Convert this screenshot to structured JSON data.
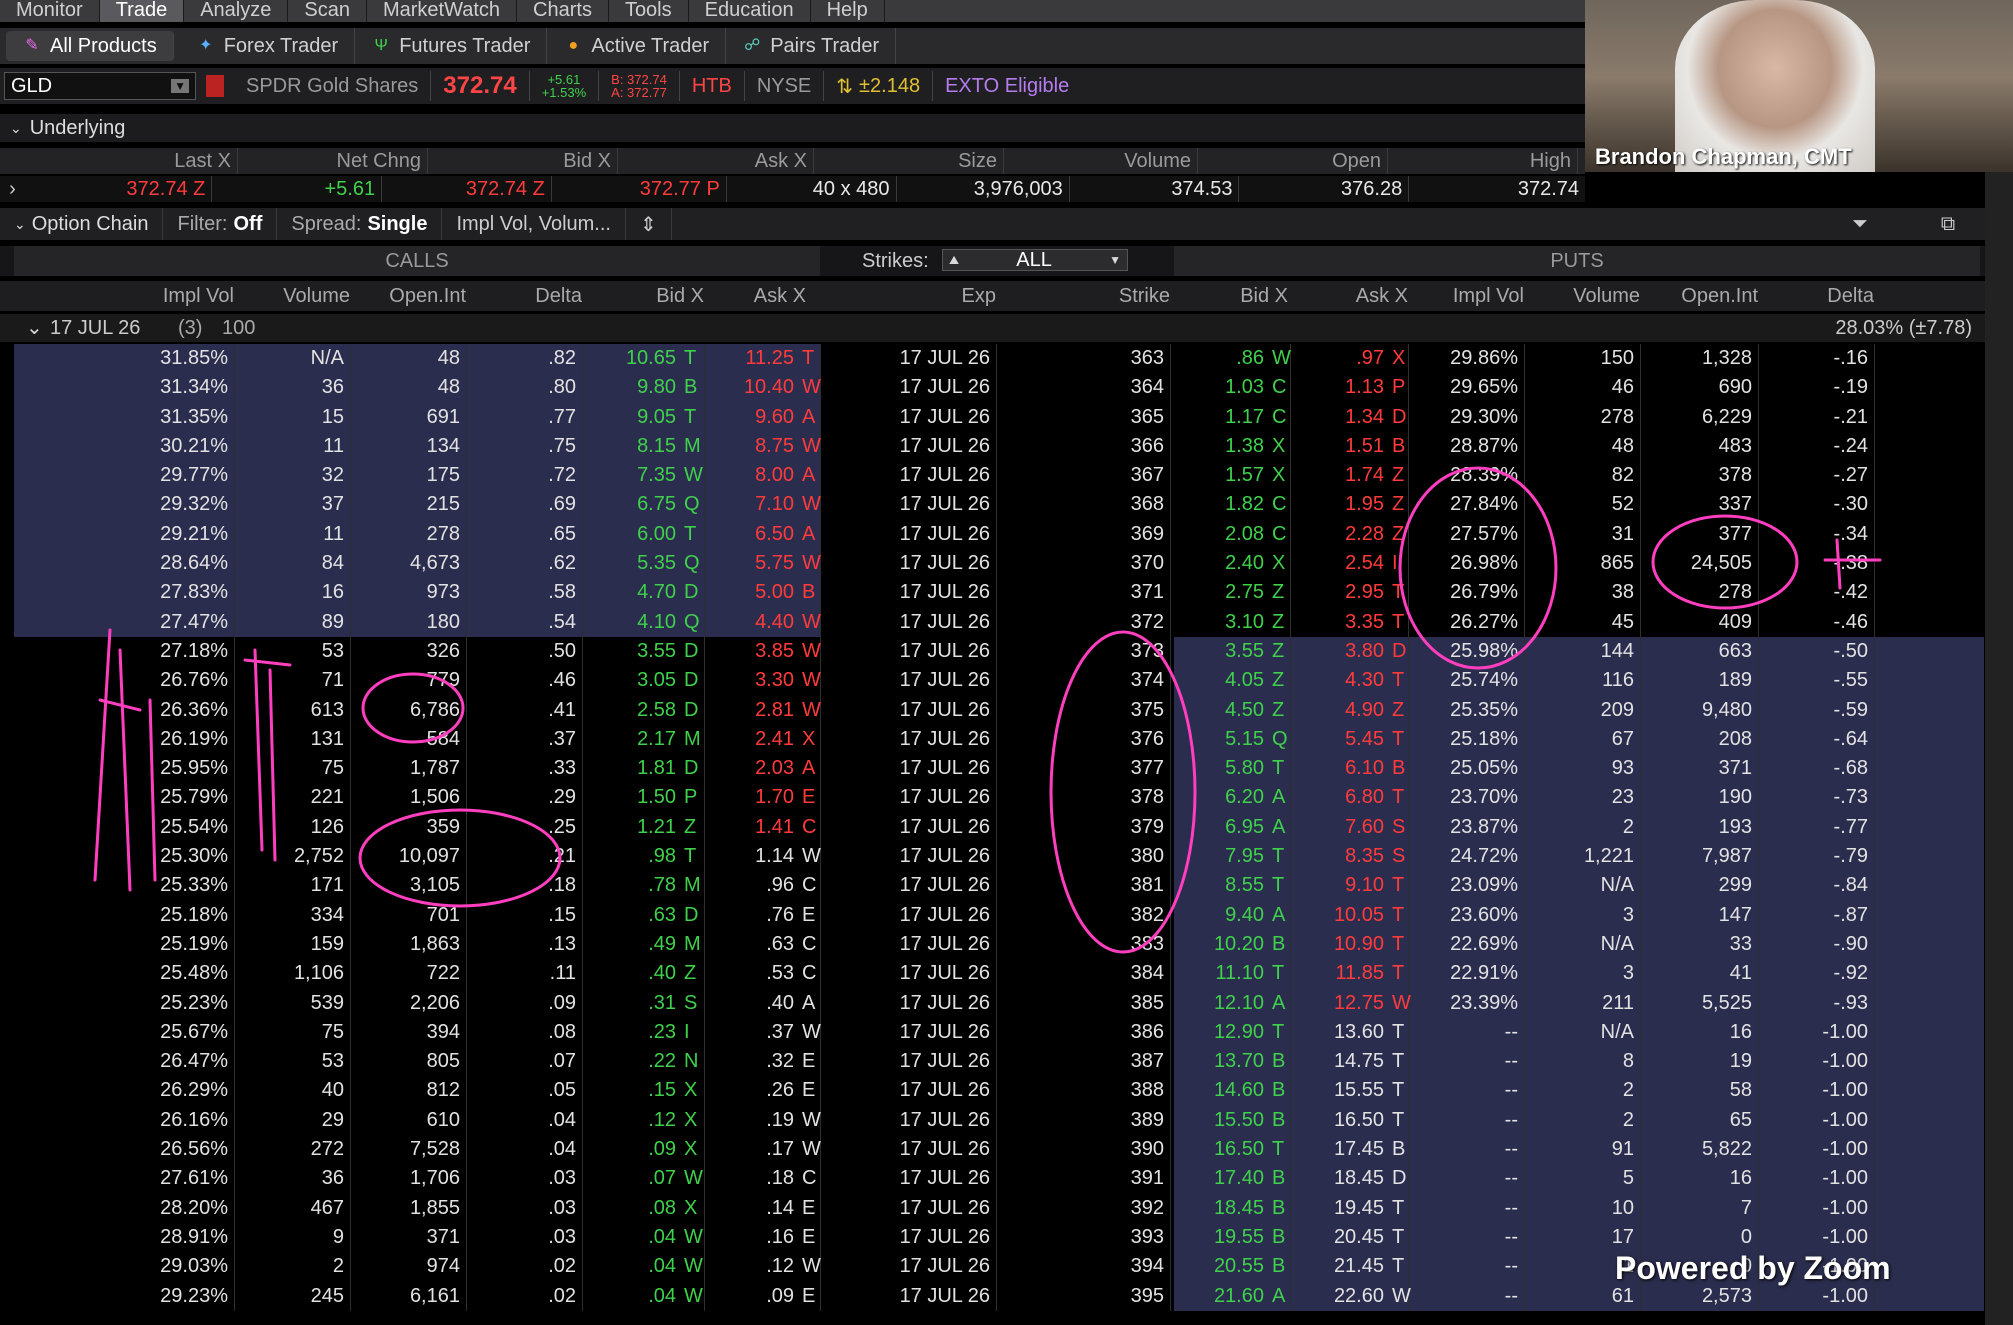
{
  "menu": [
    "Monitor",
    "Trade",
    "Analyze",
    "Scan",
    "MarketWatch",
    "Charts",
    "Tools",
    "Education",
    "Help"
  ],
  "products": [
    {
      "label": "All Products",
      "icon": "all-products-icon"
    },
    {
      "label": "Forex Trader",
      "icon": "forex-icon"
    },
    {
      "label": "Futures Trader",
      "icon": "futures-icon"
    },
    {
      "label": "Active Trader",
      "icon": "active-trader-icon"
    },
    {
      "label": "Pairs Trader",
      "icon": "pairs-icon"
    }
  ],
  "symbol": {
    "ticker": "GLD",
    "name": "SPDR Gold Shares",
    "last": "372.74",
    "chg": "+5.61",
    "chg_pct": "+1.53%",
    "bid": "B: 372.74",
    "ask": "A: 372.77",
    "htb": "HTB",
    "exchange": "NYSE",
    "move": "±2.148",
    "exto": "EXTO Eligible"
  },
  "underlying": {
    "title": "Underlying",
    "headers": [
      "Last X",
      "Net Chng",
      "Bid X",
      "Ask X",
      "Size",
      "Volume",
      "Open",
      "High"
    ],
    "values": {
      "last": "372.74",
      "last_x": "Z",
      "net_chng": "+5.61",
      "bid": "372.74",
      "bid_x": "Z",
      "ask": "372.77",
      "ask_x": "P",
      "size": "40 x 480",
      "volume": "3,976,003",
      "open": "374.53",
      "high": "376.28",
      "low": "372.74"
    }
  },
  "option_chain": {
    "title": "Option Chain",
    "filter_label": "Filter:",
    "filter_value": "Off",
    "spread_label": "Spread:",
    "spread_value": "Single",
    "layout": "Impl Vol, Volum...",
    "calls": "CALLS",
    "puts": "PUTS",
    "strikes_label": "Strikes:",
    "strikes_value": "ALL",
    "call_headers": [
      "Impl Vol",
      "Volume",
      "Open.Int",
      "Delta",
      "Bid X",
      "Ask X"
    ],
    "mid_headers": [
      "Exp",
      "Strike"
    ],
    "put_headers": [
      "Bid X",
      "Ask X",
      "Impl Vol",
      "Volume",
      "Open.Int",
      "Delta"
    ],
    "series": {
      "label": "17 JUL 26",
      "count": "(3)",
      "mult": "100",
      "iv": "28.03% (±7.78)"
    }
  },
  "rows": [
    {
      "civ": "31.85%",
      "cvol": "N/A",
      "coi": "48",
      "cd": ".82",
      "cb": "10.65",
      "cbx": "T",
      "ca": "11.25",
      "cax": "T",
      "exp": "17 JUL 26",
      "k": "363",
      "pb": ".86",
      "pbx": "W",
      "pa": ".97",
      "pax": "X",
      "piv": "29.86%",
      "pvol": "150",
      "poi": "1,328",
      "pd": "-.16"
    },
    {
      "civ": "31.34%",
      "cvol": "36",
      "coi": "48",
      "cd": ".80",
      "cb": "9.80",
      "cbx": "B",
      "ca": "10.40",
      "cax": "W",
      "exp": "17 JUL 26",
      "k": "364",
      "pb": "1.03",
      "pbx": "C",
      "pa": "1.13",
      "pax": "P",
      "piv": "29.65%",
      "pvol": "46",
      "poi": "690",
      "pd": "-.19"
    },
    {
      "civ": "31.35%",
      "cvol": "15",
      "coi": "691",
      "cd": ".77",
      "cb": "9.05",
      "cbx": "T",
      "ca": "9.60",
      "cax": "A",
      "exp": "17 JUL 26",
      "k": "365",
      "pb": "1.17",
      "pbx": "C",
      "pa": "1.34",
      "pax": "D",
      "piv": "29.30%",
      "pvol": "278",
      "poi": "6,229",
      "pd": "-.21"
    },
    {
      "civ": "30.21%",
      "cvol": "11",
      "coi": "134",
      "cd": ".75",
      "cb": "8.15",
      "cbx": "M",
      "ca": "8.75",
      "cax": "W",
      "exp": "17 JUL 26",
      "k": "366",
      "pb": "1.38",
      "pbx": "X",
      "pa": "1.51",
      "pax": "B",
      "piv": "28.87%",
      "pvol": "48",
      "poi": "483",
      "pd": "-.24"
    },
    {
      "civ": "29.77%",
      "cvol": "32",
      "coi": "175",
      "cd": ".72",
      "cb": "7.35",
      "cbx": "W",
      "ca": "8.00",
      "cax": "A",
      "exp": "17 JUL 26",
      "k": "367",
      "pb": "1.57",
      "pbx": "X",
      "pa": "1.74",
      "pax": "Z",
      "piv": "28.39%",
      "pvol": "82",
      "poi": "378",
      "pd": "-.27"
    },
    {
      "civ": "29.32%",
      "cvol": "37",
      "coi": "215",
      "cd": ".69",
      "cb": "6.75",
      "cbx": "Q",
      "ca": "7.10",
      "cax": "W",
      "exp": "17 JUL 26",
      "k": "368",
      "pb": "1.82",
      "pbx": "C",
      "pa": "1.95",
      "pax": "Z",
      "piv": "27.84%",
      "pvol": "52",
      "poi": "337",
      "pd": "-.30"
    },
    {
      "civ": "29.21%",
      "cvol": "11",
      "coi": "278",
      "cd": ".65",
      "cb": "6.00",
      "cbx": "T",
      "ca": "6.50",
      "cax": "A",
      "exp": "17 JUL 26",
      "k": "369",
      "pb": "2.08",
      "pbx": "C",
      "pa": "2.28",
      "pax": "Z",
      "piv": "27.57%",
      "pvol": "31",
      "poi": "377",
      "pd": "-.34"
    },
    {
      "civ": "28.64%",
      "cvol": "84",
      "coi": "4,673",
      "cd": ".62",
      "cb": "5.35",
      "cbx": "Q",
      "ca": "5.75",
      "cax": "W",
      "exp": "17 JUL 26",
      "k": "370",
      "pb": "2.40",
      "pbx": "X",
      "pa": "2.54",
      "pax": "I",
      "piv": "26.98%",
      "pvol": "865",
      "poi": "24,505",
      "pd": "-.38"
    },
    {
      "civ": "27.83%",
      "cvol": "16",
      "coi": "973",
      "cd": ".58",
      "cb": "4.70",
      "cbx": "D",
      "ca": "5.00",
      "cax": "B",
      "exp": "17 JUL 26",
      "k": "371",
      "pb": "2.75",
      "pbx": "Z",
      "pa": "2.95",
      "pax": "T",
      "piv": "26.79%",
      "pvol": "38",
      "poi": "278",
      "pd": "-.42"
    },
    {
      "civ": "27.47%",
      "cvol": "89",
      "coi": "180",
      "cd": ".54",
      "cb": "4.10",
      "cbx": "Q",
      "ca": "4.40",
      "cax": "W",
      "exp": "17 JUL 26",
      "k": "372",
      "pb": "3.10",
      "pbx": "Z",
      "pa": "3.35",
      "pax": "T",
      "piv": "26.27%",
      "pvol": "45",
      "poi": "409",
      "pd": "-.46"
    },
    {
      "civ": "27.18%",
      "cvol": "53",
      "coi": "326",
      "cd": ".50",
      "cb": "3.55",
      "cbx": "D",
      "ca": "3.85",
      "cax": "W",
      "exp": "17 JUL 26",
      "k": "373",
      "pb": "3.55",
      "pbx": "Z",
      "pa": "3.80",
      "pax": "D",
      "piv": "25.98%",
      "pvol": "144",
      "poi": "663",
      "pd": "-.50"
    },
    {
      "civ": "26.76%",
      "cvol": "71",
      "coi": "779",
      "cd": ".46",
      "cb": "3.05",
      "cbx": "D",
      "ca": "3.30",
      "cax": "W",
      "exp": "17 JUL 26",
      "k": "374",
      "pb": "4.05",
      "pbx": "Z",
      "pa": "4.30",
      "pax": "T",
      "piv": "25.74%",
      "pvol": "116",
      "poi": "189",
      "pd": "-.55"
    },
    {
      "civ": "26.36%",
      "cvol": "613",
      "coi": "6,786",
      "cd": ".41",
      "cb": "2.58",
      "cbx": "D",
      "ca": "2.81",
      "cax": "W",
      "exp": "17 JUL 26",
      "k": "375",
      "pb": "4.50",
      "pbx": "Z",
      "pa": "4.90",
      "pax": "Z",
      "piv": "25.35%",
      "pvol": "209",
      "poi": "9,480",
      "pd": "-.59"
    },
    {
      "civ": "26.19%",
      "cvol": "131",
      "coi": "584",
      "cd": ".37",
      "cb": "2.17",
      "cbx": "M",
      "ca": "2.41",
      "cax": "X",
      "exp": "17 JUL 26",
      "k": "376",
      "pb": "5.15",
      "pbx": "Q",
      "pa": "5.45",
      "pax": "T",
      "piv": "25.18%",
      "pvol": "67",
      "poi": "208",
      "pd": "-.64"
    },
    {
      "civ": "25.95%",
      "cvol": "75",
      "coi": "1,787",
      "cd": ".33",
      "cb": "1.81",
      "cbx": "D",
      "ca": "2.03",
      "cax": "A",
      "exp": "17 JUL 26",
      "k": "377",
      "pb": "5.80",
      "pbx": "T",
      "pa": "6.10",
      "pax": "B",
      "piv": "25.05%",
      "pvol": "93",
      "poi": "371",
      "pd": "-.68"
    },
    {
      "civ": "25.79%",
      "cvol": "221",
      "coi": "1,506",
      "cd": ".29",
      "cb": "1.50",
      "cbx": "P",
      "ca": "1.70",
      "cax": "E",
      "exp": "17 JUL 26",
      "k": "378",
      "pb": "6.20",
      "pbx": "A",
      "pa": "6.80",
      "pax": "T",
      "piv": "23.70%",
      "pvol": "23",
      "poi": "190",
      "pd": "-.73"
    },
    {
      "civ": "25.54%",
      "cvol": "126",
      "coi": "359",
      "cd": ".25",
      "cb": "1.21",
      "cbx": "Z",
      "ca": "1.41",
      "cax": "C",
      "exp": "17 JUL 26",
      "k": "379",
      "pb": "6.95",
      "pbx": "A",
      "pa": "7.60",
      "pax": "S",
      "piv": "23.87%",
      "pvol": "2",
      "poi": "193",
      "pd": "-.77"
    },
    {
      "civ": "25.30%",
      "cvol": "2,752",
      "coi": "10,097",
      "cd": ".21",
      "cb": ".98",
      "cbx": "T",
      "ca": "1.14",
      "cax": "W",
      "exp": "17 JUL 26",
      "k": "380",
      "pb": "7.95",
      "pbx": "T",
      "pa": "8.35",
      "pax": "S",
      "piv": "24.72%",
      "pvol": "1,221",
      "poi": "7,987",
      "pd": "-.79"
    },
    {
      "civ": "25.33%",
      "cvol": "171",
      "coi": "3,105",
      "cd": ".18",
      "cb": ".78",
      "cbx": "M",
      "ca": ".96",
      "cax": "C",
      "exp": "17 JUL 26",
      "k": "381",
      "pb": "8.55",
      "pbx": "T",
      "pa": "9.10",
      "pax": "T",
      "piv": "23.09%",
      "pvol": "N/A",
      "poi": "299",
      "pd": "-.84"
    },
    {
      "civ": "25.18%",
      "cvol": "334",
      "coi": "701",
      "cd": ".15",
      "cb": ".63",
      "cbx": "D",
      "ca": ".76",
      "cax": "E",
      "exp": "17 JUL 26",
      "k": "382",
      "pb": "9.40",
      "pbx": "A",
      "pa": "10.05",
      "pax": "T",
      "piv": "23.60%",
      "pvol": "3",
      "poi": "147",
      "pd": "-.87"
    },
    {
      "civ": "25.19%",
      "cvol": "159",
      "coi": "1,863",
      "cd": ".13",
      "cb": ".49",
      "cbx": "M",
      "ca": ".63",
      "cax": "C",
      "exp": "17 JUL 26",
      "k": "383",
      "pb": "10.20",
      "pbx": "B",
      "pa": "10.90",
      "pax": "T",
      "piv": "22.69%",
      "pvol": "N/A",
      "poi": "33",
      "pd": "-.90"
    },
    {
      "civ": "25.48%",
      "cvol": "1,106",
      "coi": "722",
      "cd": ".11",
      "cb": ".40",
      "cbx": "Z",
      "ca": ".53",
      "cax": "C",
      "exp": "17 JUL 26",
      "k": "384",
      "pb": "11.10",
      "pbx": "T",
      "pa": "11.85",
      "pax": "T",
      "piv": "22.91%",
      "pvol": "3",
      "poi": "41",
      "pd": "-.92"
    },
    {
      "civ": "25.23%",
      "cvol": "539",
      "coi": "2,206",
      "cd": ".09",
      "cb": ".31",
      "cbx": "S",
      "ca": ".40",
      "cax": "A",
      "exp": "17 JUL 26",
      "k": "385",
      "pb": "12.10",
      "pbx": "A",
      "pa": "12.75",
      "pax": "W",
      "piv": "23.39%",
      "pvol": "211",
      "poi": "5,525",
      "pd": "-.93"
    },
    {
      "civ": "25.67%",
      "cvol": "75",
      "coi": "394",
      "cd": ".08",
      "cb": ".23",
      "cbx": "I",
      "ca": ".37",
      "cax": "W",
      "exp": "17 JUL 26",
      "k": "386",
      "pb": "12.90",
      "pbx": "T",
      "pa": "13.60",
      "pax": "T",
      "piv": "--",
      "pvol": "N/A",
      "poi": "16",
      "pd": "-1.00"
    },
    {
      "civ": "26.47%",
      "cvol": "53",
      "coi": "805",
      "cd": ".07",
      "cb": ".22",
      "cbx": "N",
      "ca": ".32",
      "cax": "E",
      "exp": "17 JUL 26",
      "k": "387",
      "pb": "13.70",
      "pbx": "B",
      "pa": "14.75",
      "pax": "T",
      "piv": "--",
      "pvol": "8",
      "poi": "19",
      "pd": "-1.00"
    },
    {
      "civ": "26.29%",
      "cvol": "40",
      "coi": "812",
      "cd": ".05",
      "cb": ".15",
      "cbx": "X",
      "ca": ".26",
      "cax": "E",
      "exp": "17 JUL 26",
      "k": "388",
      "pb": "14.60",
      "pbx": "B",
      "pa": "15.55",
      "pax": "T",
      "piv": "--",
      "pvol": "2",
      "poi": "58",
      "pd": "-1.00"
    },
    {
      "civ": "26.16%",
      "cvol": "29",
      "coi": "610",
      "cd": ".04",
      "cb": ".12",
      "cbx": "X",
      "ca": ".19",
      "cax": "W",
      "exp": "17 JUL 26",
      "k": "389",
      "pb": "15.50",
      "pbx": "B",
      "pa": "16.50",
      "pax": "T",
      "piv": "--",
      "pvol": "2",
      "poi": "65",
      "pd": "-1.00"
    },
    {
      "civ": "26.56%",
      "cvol": "272",
      "coi": "7,528",
      "cd": ".04",
      "cb": ".09",
      "cbx": "X",
      "ca": ".17",
      "cax": "W",
      "exp": "17 JUL 26",
      "k": "390",
      "pb": "16.50",
      "pbx": "T",
      "pa": "17.45",
      "pax": "B",
      "piv": "--",
      "pvol": "91",
      "poi": "5,822",
      "pd": "-1.00"
    },
    {
      "civ": "27.61%",
      "cvol": "36",
      "coi": "1,706",
      "cd": ".03",
      "cb": ".07",
      "cbx": "W",
      "ca": ".18",
      "cax": "C",
      "exp": "17 JUL 26",
      "k": "391",
      "pb": "17.40",
      "pbx": "B",
      "pa": "18.45",
      "pax": "D",
      "piv": "--",
      "pvol": "5",
      "poi": "16",
      "pd": "-1.00"
    },
    {
      "civ": "28.20%",
      "cvol": "467",
      "coi": "1,855",
      "cd": ".03",
      "cb": ".08",
      "cbx": "X",
      "ca": ".14",
      "cax": "E",
      "exp": "17 JUL 26",
      "k": "392",
      "pb": "18.45",
      "pbx": "B",
      "pa": "19.45",
      "pax": "T",
      "piv": "--",
      "pvol": "10",
      "poi": "7",
      "pd": "-1.00"
    },
    {
      "civ": "28.91%",
      "cvol": "9",
      "coi": "371",
      "cd": ".03",
      "cb": ".04",
      "cbx": "W",
      "ca": ".16",
      "cax": "E",
      "exp": "17 JUL 26",
      "k": "393",
      "pb": "19.55",
      "pbx": "B",
      "pa": "20.45",
      "pax": "T",
      "piv": "--",
      "pvol": "17",
      "poi": "0",
      "pd": "-1.00"
    },
    {
      "civ": "29.03%",
      "cvol": "2",
      "coi": "974",
      "cd": ".02",
      "cb": ".04",
      "cbx": "W",
      "ca": ".12",
      "cax": "W",
      "exp": "17 JUL 26",
      "k": "394",
      "pb": "20.55",
      "pbx": "B",
      "pa": "21.45",
      "pax": "T",
      "piv": "--",
      "pvol": "1",
      "poi": "0",
      "pd": "-1.00"
    },
    {
      "civ": "29.23%",
      "cvol": "245",
      "coi": "6,161",
      "cd": ".02",
      "cb": ".04",
      "cbx": "W",
      "ca": ".09",
      "cax": "E",
      "exp": "17 JUL 26",
      "k": "395",
      "pb": "21.60",
      "pbx": "A",
      "pa": "22.60",
      "pax": "W",
      "piv": "--",
      "pvol": "61",
      "poi": "2,573",
      "pd": "-1.00"
    }
  ],
  "video": {
    "name": "Brandon Chapman, CMT"
  },
  "watermark": "Powered by Zoom"
}
